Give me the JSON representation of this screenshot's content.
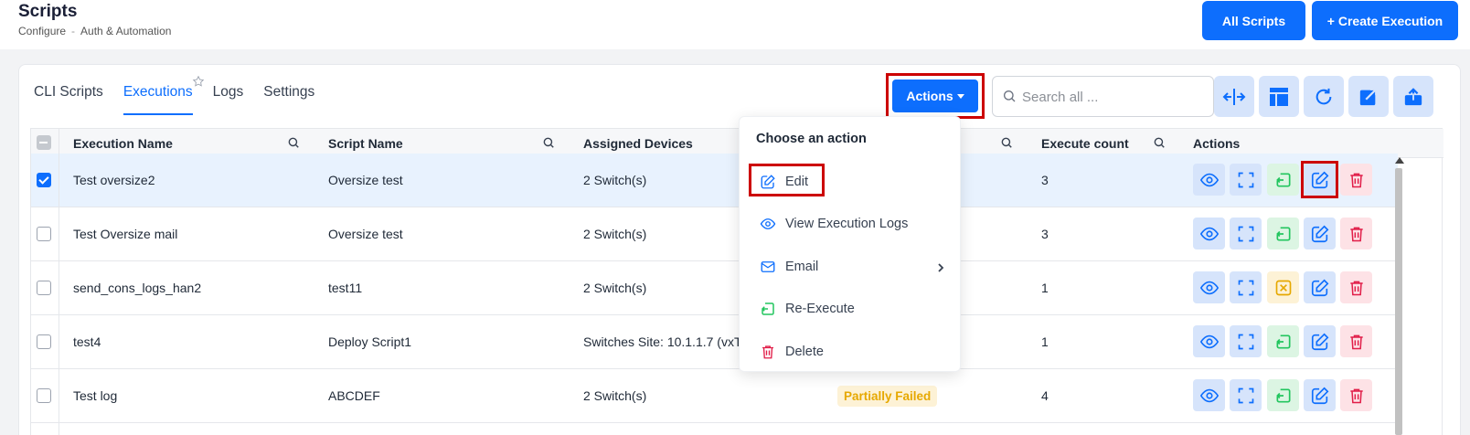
{
  "header": {
    "title": "Scripts",
    "breadcrumb": [
      "Configure",
      "Auth & Automation"
    ],
    "breadcrumb_sep": "-",
    "all_scripts_label": "All Scripts",
    "create_execution_label": "+ Create Execution"
  },
  "tabs": [
    "CLI Scripts",
    "Executions",
    "Logs",
    "Settings"
  ],
  "active_tab": "Executions",
  "toolbar": {
    "actions_label": "Actions",
    "search_placeholder": "Search all ...",
    "tool_icons": [
      "split-columns-icon",
      "layout-icon",
      "refresh-icon",
      "export-icon",
      "upload-icon"
    ]
  },
  "table": {
    "columns": [
      "Execution Name",
      "Script Name",
      "Assigned Devices",
      "Execute count",
      "Actions"
    ],
    "rows": [
      {
        "name": "Test oversize2",
        "script": "Oversize test",
        "devices": "2 Switch(s)",
        "status": "",
        "count": "3",
        "checked": true,
        "third_action": "re-execute"
      },
      {
        "name": "Test Oversize mail",
        "script": "Oversize test",
        "devices": "2 Switch(s)",
        "status": "",
        "count": "3",
        "checked": false,
        "third_action": "re-execute"
      },
      {
        "name": "send_cons_logs_han2",
        "script": "test11",
        "devices": "2 Switch(s)",
        "status": "",
        "count": "1",
        "checked": false,
        "third_action": "cancel"
      },
      {
        "name": "test4",
        "script": "Deploy Script1",
        "devices": "Switches Site: 10.1.1.7 (vxTarg",
        "status": "",
        "count": "1",
        "checked": false,
        "third_action": "re-execute"
      },
      {
        "name": "Test log",
        "script": "ABCDEF",
        "devices": "2 Switch(s)",
        "status": "Partially Failed",
        "count": "4",
        "checked": false,
        "third_action": "re-execute"
      }
    ]
  },
  "menu": {
    "title": "Choose an action",
    "items": [
      "Edit",
      "View Execution Logs",
      "Email",
      "Re-Execute",
      "Delete"
    ]
  },
  "colors": {
    "primary": "#0d6efd",
    "highlight": "#cc0000",
    "warning": "#e6a800",
    "success": "#22c55e",
    "danger": "#e11d48"
  }
}
